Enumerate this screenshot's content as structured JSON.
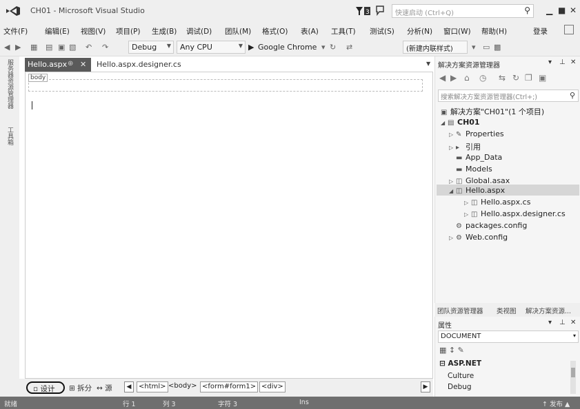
{
  "window": {
    "title": "CH01 - Microsoft Visual Studio",
    "quick_launch_placeholder": "快速启动 (Ctrl+Q)"
  },
  "menu": [
    "文件(F)",
    "编辑(E)",
    "视图(V)",
    "项目(P)",
    "生成(B)",
    "调试(D)",
    "团队(M)",
    "格式(O)",
    "表(A)",
    "工具(T)",
    "测试(S)",
    "分析(N)",
    "窗口(W)",
    "帮助(H)"
  ],
  "menu_login": "登录",
  "toolbar": {
    "config": "Debug",
    "platform": "Any CPU",
    "browser": "Google Chrome",
    "style": "(新建内联样式)"
  },
  "left_tabs": [
    "服务器资源管理器",
    "工具箱"
  ],
  "doc_tabs": {
    "active": "Hello.aspx",
    "other": "Hello.aspx.designer.cs"
  },
  "editor": {
    "body_tag": "body"
  },
  "view_bar": {
    "design": "设计",
    "split": "拆分",
    "source": "源",
    "breadcrumbs": [
      "<html>",
      "<body>",
      "<form#form1>",
      "<div>"
    ]
  },
  "status": {
    "ready": "就绪",
    "line": "行 1",
    "col": "列 3",
    "char": "字符 3",
    "ins": "Ins",
    "publish": "↑ 发布 ▲"
  },
  "solution_explorer": {
    "title": "解决方案资源管理器",
    "search_placeholder": "搜索解决方案资源管理器(Ctrl+;)",
    "items": [
      {
        "label": "解决方案\"CH01\"(1 个项目)",
        "icon": "solution-icon"
      },
      {
        "label": "CH01",
        "icon": "project-icon"
      },
      {
        "label": "Properties",
        "icon": "wrench-icon"
      },
      {
        "label": "引用",
        "icon": "references-icon"
      },
      {
        "label": "App_Data",
        "icon": "folder-icon"
      },
      {
        "label": "Models",
        "icon": "folder-icon"
      },
      {
        "label": "Global.asax",
        "icon": "file-icon"
      },
      {
        "label": "Hello.aspx",
        "icon": "file-icon"
      },
      {
        "label": "Hello.aspx.cs",
        "icon": "file-icon"
      },
      {
        "label": "Hello.aspx.designer.cs",
        "icon": "file-icon"
      },
      {
        "label": "packages.config",
        "icon": "config-icon"
      },
      {
        "label": "Web.config",
        "icon": "config-icon"
      }
    ]
  },
  "panel_tabs": [
    "团队资源管理器",
    "类视图",
    "解决方案资源..."
  ],
  "properties": {
    "title": "属性",
    "object": "DOCUMENT",
    "category": "ASP.NET",
    "items": [
      "Culture",
      "Debug"
    ]
  }
}
